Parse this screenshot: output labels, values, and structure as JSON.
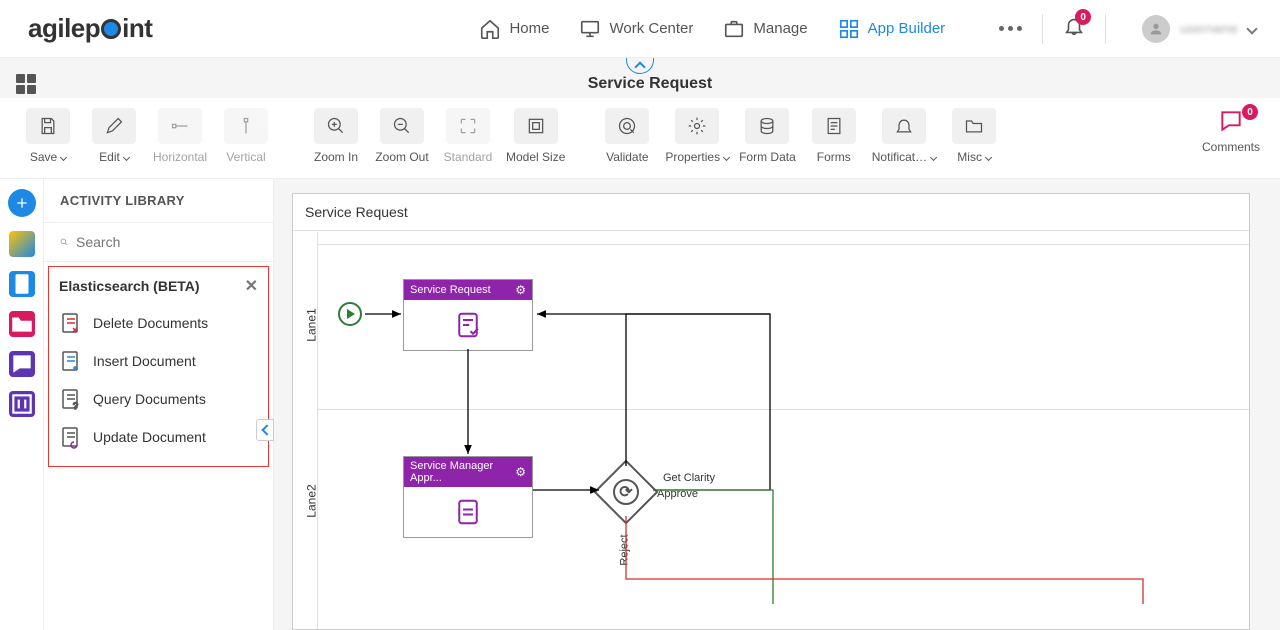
{
  "brand": {
    "pre": "agilep",
    "post": "int"
  },
  "nav": {
    "home": "Home",
    "work_center": "Work Center",
    "manage": "Manage",
    "app_builder": "App Builder"
  },
  "notifications": {
    "count": "0"
  },
  "user": {
    "name": "username"
  },
  "app": {
    "title": "Service Request"
  },
  "toolbar": {
    "save": "Save",
    "edit": "Edit",
    "horizontal": "Horizontal",
    "vertical": "Vertical",
    "zoom_in": "Zoom In",
    "zoom_out": "Zoom Out",
    "standard": "Standard",
    "model_size": "Model Size",
    "validate": "Validate",
    "properties": "Properties",
    "form_data": "Form Data",
    "forms": "Forms",
    "notifications": "Notificat…",
    "misc": "Misc",
    "comments": "Comments",
    "comments_count": "0"
  },
  "panel": {
    "title": "ACTIVITY LIBRARY",
    "search_placeholder": "Search",
    "group_title": "Elasticsearch (BETA)",
    "items": [
      {
        "label": "Delete Documents"
      },
      {
        "label": "Insert Document"
      },
      {
        "label": "Query Documents"
      },
      {
        "label": "Update Document"
      }
    ]
  },
  "canvas": {
    "title": "Service Request",
    "lane1": "Lane1",
    "lane2": "Lane2",
    "node1_title": "Service Request",
    "node2_title": "Service Manager Appr...",
    "gw_label1": "Get Clarity",
    "gw_label2": "Approve",
    "gw_label3": "Reject"
  }
}
